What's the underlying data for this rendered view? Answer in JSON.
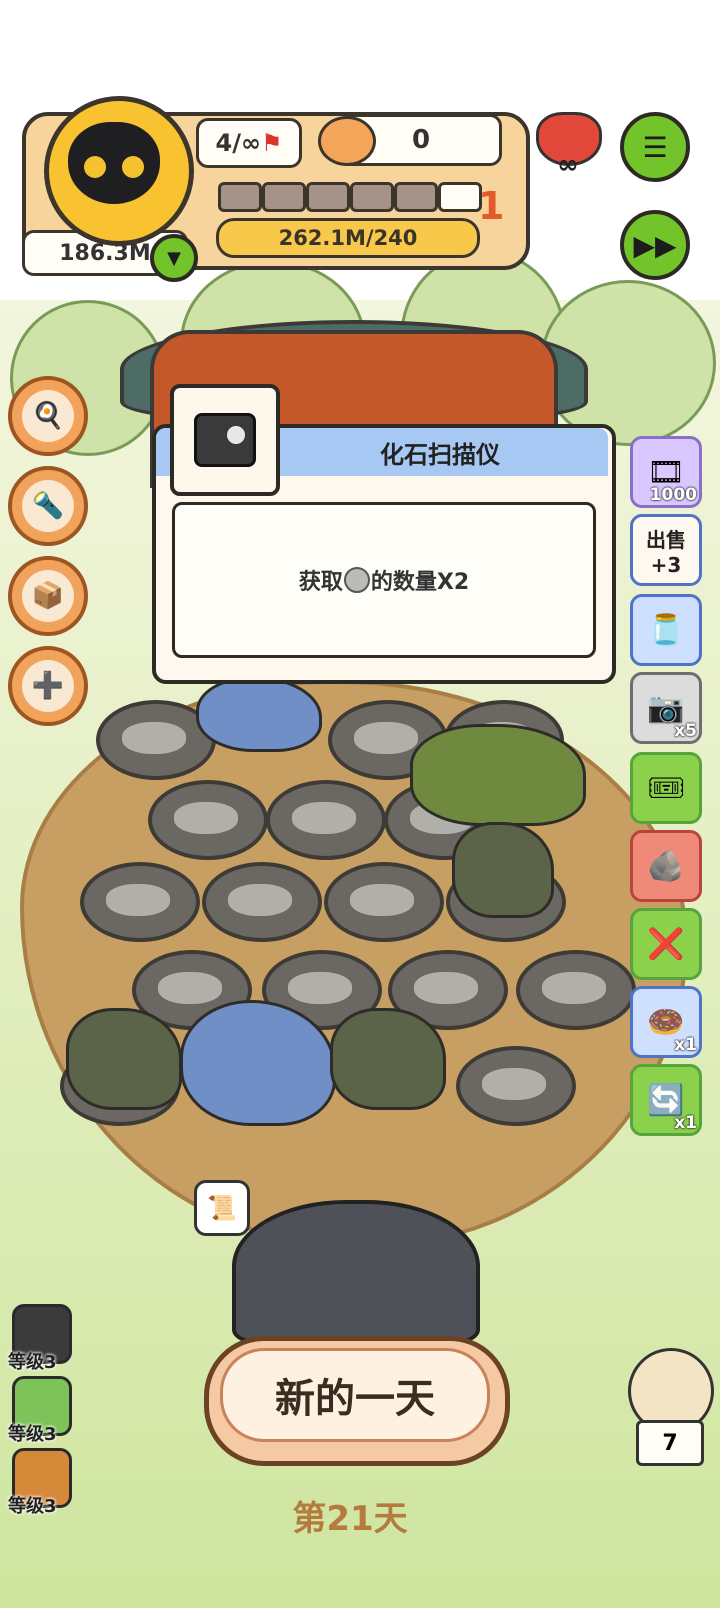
{
  "hud": {
    "capacity": "4/∞",
    "bowl_count": "0",
    "money": "186.3M",
    "level_number": "1",
    "xp_text": "262.1M/240",
    "infinite_symbol": "∞",
    "xp_segments_filled": 5,
    "xp_segments_total": 6
  },
  "right_items": [
    {
      "badge": "1000",
      "icon": "film-reel"
    },
    {
      "label": "出售",
      "badge": "+3",
      "icon": "sell-bowl"
    },
    {
      "badge": "",
      "icon": "jar"
    },
    {
      "badge": "x5",
      "icon": "fossil-scanner"
    },
    {
      "badge": "",
      "icon": "ticket-refresh"
    },
    {
      "badge": "",
      "icon": "fossil-rock"
    },
    {
      "badge": "",
      "icon": "cancel-ticket"
    },
    {
      "badge": "x1",
      "icon": "donut"
    },
    {
      "badge": "x1",
      "icon": "swap-ticket"
    }
  ],
  "popup": {
    "title": "化石扫描仪",
    "text_before": "获取",
    "text_after": "的数量X2"
  },
  "levels": [
    {
      "label": "等级3",
      "color": "#3b3b3b"
    },
    {
      "label": "等级3",
      "color": "#7ec35a"
    },
    {
      "label": "等级3",
      "color": "#d58a3a"
    }
  ],
  "bottom": {
    "new_day": "新的一天",
    "day_label": "第21天",
    "owl_count": "7"
  },
  "colors": {
    "accent_green": "#73c42b",
    "hud_orange": "#f6d49c",
    "popup_blue": "#a7c8f3"
  }
}
